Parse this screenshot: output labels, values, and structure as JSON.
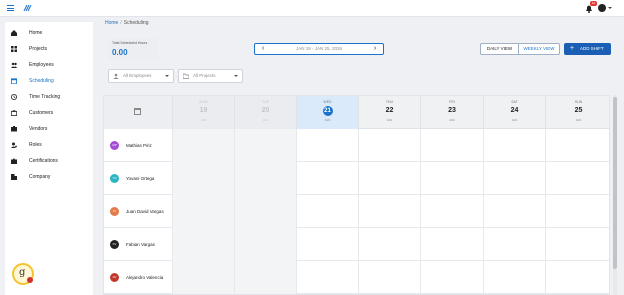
{
  "header": {
    "notification_count": "10"
  },
  "sidebar": {
    "items": [
      {
        "label": "Home",
        "icon": "home-icon"
      },
      {
        "label": "Projects",
        "icon": "projects-icon"
      },
      {
        "label": "Employees",
        "icon": "employees-icon"
      },
      {
        "label": "Scheduling",
        "icon": "calendar-icon",
        "active": true
      },
      {
        "label": "Time Tracking",
        "icon": "clock-icon"
      },
      {
        "label": "Customers",
        "icon": "briefcase-icon"
      },
      {
        "label": "Vendors",
        "icon": "vendors-icon"
      },
      {
        "label": "Roles",
        "icon": "roles-icon"
      },
      {
        "label": "Certifications",
        "icon": "certifications-icon"
      },
      {
        "label": "Company",
        "icon": "company-icon"
      }
    ]
  },
  "breadcrumb": {
    "home": "Home",
    "separator": "/",
    "current": "Scheduling"
  },
  "stats": {
    "title": "Total Scheduled Hours",
    "value": "0.00"
  },
  "date_nav": {
    "range": "JAN 19 - JAN 25, 2026"
  },
  "view_toggle": {
    "daily": "DAILY VIEW",
    "weekly": "WEEKLY VIEW"
  },
  "add_shift": {
    "label": "ADD SHIFT"
  },
  "filters": {
    "employees": "All Employees",
    "projects": "All Projects"
  },
  "calendar": {
    "days": [
      {
        "name": "MON",
        "date": "19",
        "month": "JAN",
        "state": "past"
      },
      {
        "name": "TUE",
        "date": "20",
        "month": "JAN",
        "state": "past"
      },
      {
        "name": "WED",
        "date": "21",
        "month": "JAN",
        "state": "today"
      },
      {
        "name": "THU",
        "date": "22",
        "month": "JAN",
        "state": "future"
      },
      {
        "name": "FRI",
        "date": "23",
        "month": "JAN",
        "state": "future"
      },
      {
        "name": "SAT",
        "date": "24",
        "month": "JAN",
        "state": "future"
      },
      {
        "name": "SUN",
        "date": "25",
        "month": "JAN",
        "state": "future"
      }
    ],
    "employees": [
      {
        "name": "Mathias Piriz",
        "initials": "MP",
        "color": "#a54bd8"
      },
      {
        "name": "Yovani Ortega",
        "initials": "YO",
        "color": "#2bb4c4"
      },
      {
        "name": "Juan David Vargas",
        "initials": "JV",
        "color": "#e27b4a"
      },
      {
        "name": "Fabian Vargas",
        "initials": "FV",
        "color": "#222222"
      },
      {
        "name": "Alejandro Valencia",
        "initials": "AV",
        "color": "#c0392b"
      }
    ]
  },
  "colors": {
    "accent": "#1a73c8",
    "primary_button": "#1a5fb4",
    "today": "#dbeafb"
  }
}
